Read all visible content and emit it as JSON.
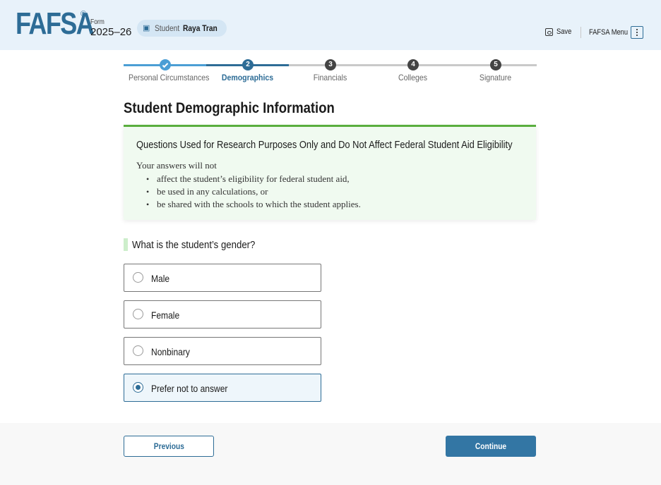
{
  "header": {
    "logo": "FAFSA",
    "logo_mark": "®",
    "form_label": "Form",
    "form_year": "2025–26",
    "student_label": "Student",
    "student_name": "Raya Tran",
    "save_label": "Save",
    "menu_label": "FAFSA Menu"
  },
  "stepper": {
    "steps": [
      {
        "number": "1",
        "label": "Personal Circumstances",
        "status": "complete"
      },
      {
        "number": "2",
        "label": "Demographics",
        "status": "current"
      },
      {
        "number": "3",
        "label": "Financials",
        "status": "upcoming"
      },
      {
        "number": "4",
        "label": "Colleges",
        "status": "upcoming"
      },
      {
        "number": "5",
        "label": "Signature",
        "status": "upcoming"
      }
    ]
  },
  "page": {
    "title": "Student Demographic Information"
  },
  "info_box": {
    "title": "Questions Used for Research Purposes Only and Do Not Affect Federal Student Aid Eligibility",
    "intro": "Your answers will not",
    "bullets": [
      "affect the student’s eligibility for federal student aid,",
      "be used in any calculations, or",
      "be shared with the schools to which the student applies."
    ]
  },
  "question": {
    "text": "What is the student’s gender?",
    "options": [
      {
        "label": "Male",
        "selected": false
      },
      {
        "label": "Female",
        "selected": false
      },
      {
        "label": "Nonbinary",
        "selected": false
      },
      {
        "label": "Prefer not to answer",
        "selected": true
      }
    ]
  },
  "footer": {
    "previous_label": "Previous",
    "continue_label": "Continue"
  },
  "colors": {
    "brand": "#2d6c96",
    "complete": "#4b9ed5",
    "info_accent": "#5aae3e",
    "header_bg": "#e8f2fa"
  }
}
